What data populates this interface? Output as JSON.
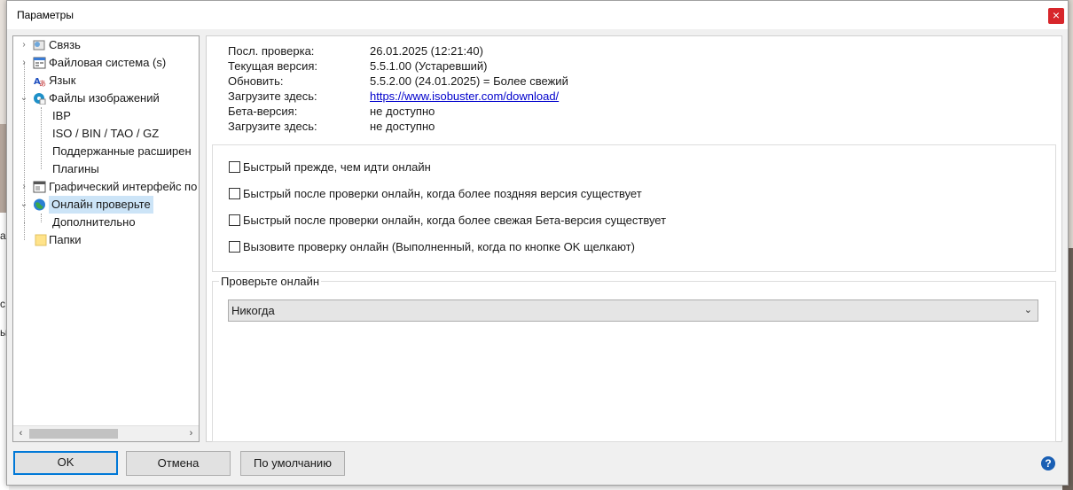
{
  "window": {
    "title": "Параметры",
    "close_glyph": "×"
  },
  "background": {
    "frag1": "ая",
    "frag2": "с",
    "frag3": "ы"
  },
  "tree": {
    "items": [
      {
        "label": "Связь",
        "icon": "connection-icon",
        "expander": "›"
      },
      {
        "label": "Файловая система (s)",
        "icon": "file-system-icon",
        "expander": "›"
      },
      {
        "label": "Язык",
        "icon": "language-icon",
        "expander": ""
      },
      {
        "label": "Файлы изображений",
        "icon": "image-files-icon",
        "expander": "⌄"
      },
      {
        "label": "IBP",
        "icon": "",
        "expander": ""
      },
      {
        "label": "ISO / BIN / TAO / GZ",
        "icon": "",
        "expander": ""
      },
      {
        "label": "Поддержанные расширен",
        "icon": "",
        "expander": ""
      },
      {
        "label": "Плагины",
        "icon": "",
        "expander": ""
      },
      {
        "label": "Графический интерфейс по",
        "icon": "gui-icon",
        "expander": "›"
      },
      {
        "label": "Онлайн проверьте",
        "icon": "globe-icon",
        "expander": "⌄"
      },
      {
        "label": "Дополнительно",
        "icon": "",
        "expander": ""
      },
      {
        "label": "Папки",
        "icon": "folder-icon",
        "expander": ""
      }
    ],
    "scroll_left": "‹",
    "scroll_right": "›"
  },
  "info": {
    "rows": [
      {
        "key": "Посл. проверка:",
        "value": "26.01.2025 (12:21:40)"
      },
      {
        "key": "Текущая версия:",
        "value": "5.5.1.00 (Устаревший)"
      },
      {
        "key": "Обновить:",
        "value": "5.5.2.00 (24.01.2025) = Более свежий"
      },
      {
        "key": "Загрузите здесь:",
        "value": "https://www.isobuster.com/download/"
      },
      {
        "key": "Бета-версия:",
        "value": "не доступно"
      },
      {
        "key": "Загрузите здесь:",
        "value": "не доступно"
      }
    ]
  },
  "options": [
    "Быстрый прежде, чем идти онлайн",
    "Быстрый после проверки онлайн, когда более поздняя версия существует",
    "Быстрый после проверки онлайн, когда более свежая Бета-версия существует",
    "Вызовите проверку онлайн (Выполненный, когда по кнопке OK щелкают)"
  ],
  "check_group": {
    "title": "Проверьте онлайн",
    "selected": "Никогда",
    "chevron": "⌄"
  },
  "buttons": {
    "ok": "OK",
    "cancel": "Отмена",
    "defaults": "По умолчанию",
    "help": "?"
  },
  "colors": {
    "accent": "#0078d7",
    "selection": "#cce4f7",
    "link": "#0000cc",
    "close": "#d7262b"
  }
}
